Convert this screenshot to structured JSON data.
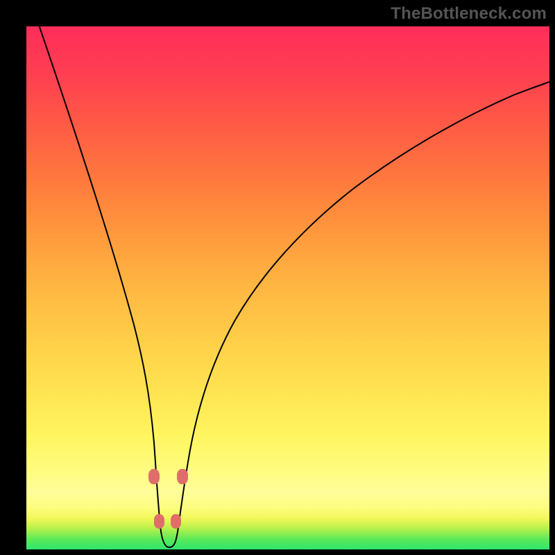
{
  "watermark": "TheBottleneck.com",
  "colors": {
    "frame_bg": "#000000",
    "curve_stroke": "#000000",
    "bead_fill": "#df6e6a"
  },
  "chart_data": {
    "type": "line",
    "title": "",
    "xlabel": "",
    "ylabel": "",
    "xlim": [
      0,
      100
    ],
    "ylim": [
      0,
      100
    ],
    "grid": false,
    "legend": false,
    "x": [
      0,
      5,
      10,
      15,
      18,
      20,
      22,
      23.5,
      24.5,
      25.5,
      26.5,
      27.5,
      28.5,
      29.5,
      31,
      33,
      36,
      40,
      45,
      50,
      55,
      60,
      65,
      70,
      75,
      80,
      85,
      90,
      95,
      100
    ],
    "y": [
      105,
      93,
      80,
      64,
      52,
      42,
      30,
      18,
      10,
      4,
      2,
      2,
      4,
      10,
      20,
      32,
      45,
      56,
      64,
      70,
      74.5,
      78,
      81,
      83.2,
      85,
      86.5,
      87.6,
      88.5,
      89.2,
      89.8
    ],
    "markers": {
      "x": [
        23.8,
        24.8,
        28.0,
        29.1
      ],
      "y": [
        14,
        6,
        6,
        14
      ]
    },
    "note": "x spans plot width fraction 0–100; y is bottleneck %, 0 = bottom (green), 100 = top (red). Readable values estimated from pixel positions; no labeled axes in source image."
  }
}
